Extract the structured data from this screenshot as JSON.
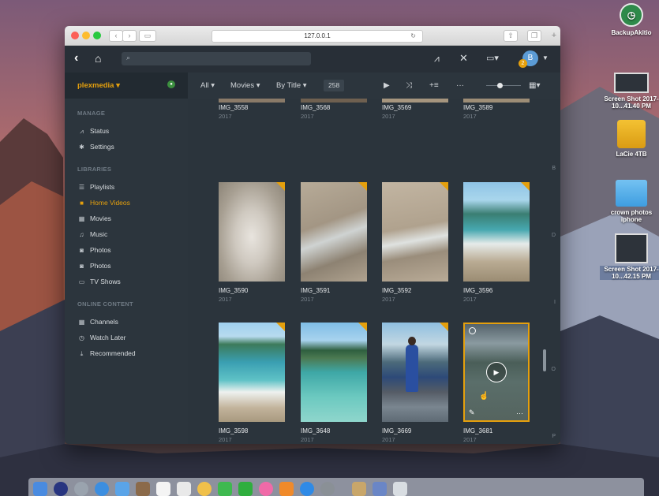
{
  "browser": {
    "url": "127.0.0.1"
  },
  "desktop_icons": [
    {
      "label": "BackupAkitio"
    },
    {
      "label": "Screen Shot 2017-10...41.40 PM"
    },
    {
      "label": "LaCie 4TB"
    },
    {
      "label": "crown photos iphone"
    },
    {
      "label": "Screen Shot 2017-10...42.15 PM"
    }
  ],
  "header": {
    "user_initial": "B",
    "notification_count": "2"
  },
  "sidebar": {
    "server_name": "plexmedia ▾",
    "manage_heading": "MANAGE",
    "manage_items": [
      {
        "label": "Status"
      },
      {
        "label": "Settings"
      }
    ],
    "libraries_heading": "LIBRARIES",
    "library_items": [
      {
        "label": "Playlists"
      },
      {
        "label": "Home Videos"
      },
      {
        "label": "Movies"
      },
      {
        "label": "Music"
      },
      {
        "label": "Photos"
      },
      {
        "label": "Photos"
      },
      {
        "label": "TV Shows"
      }
    ],
    "online_heading": "ONLINE CONTENT",
    "online_items": [
      {
        "label": "Channels"
      },
      {
        "label": "Watch Later"
      },
      {
        "label": "Recommended"
      }
    ]
  },
  "toolbar": {
    "filter_all": "All ▾",
    "filter_type": "Movies ▾",
    "sort": "By Title ▾",
    "count": "258"
  },
  "grid": {
    "row1": [
      {
        "title": "IMG_3558",
        "year": "2017"
      },
      {
        "title": "IMG_3568",
        "year": "2017"
      },
      {
        "title": "IMG_3569",
        "year": "2017"
      },
      {
        "title": "IMG_3589",
        "year": "2017"
      }
    ],
    "row2": [
      {
        "title": "IMG_3590",
        "year": "2017"
      },
      {
        "title": "IMG_3591",
        "year": "2017"
      },
      {
        "title": "IMG_3592",
        "year": "2017"
      },
      {
        "title": "IMG_3596",
        "year": "2017"
      }
    ],
    "row3": [
      {
        "title": "IMG_3598",
        "year": "2017"
      },
      {
        "title": "IMG_3648",
        "year": "2017"
      },
      {
        "title": "IMG_3669",
        "year": "2017"
      },
      {
        "title": "IMG_3681",
        "year": "2017"
      }
    ]
  },
  "alpha_index": [
    "B",
    "D",
    "I",
    "O",
    "P"
  ],
  "colors": {
    "accent": "#e5a00d",
    "sidebar_bg": "#2c353d",
    "content_bg": "#2b343c",
    "header_bg": "#282f37"
  }
}
